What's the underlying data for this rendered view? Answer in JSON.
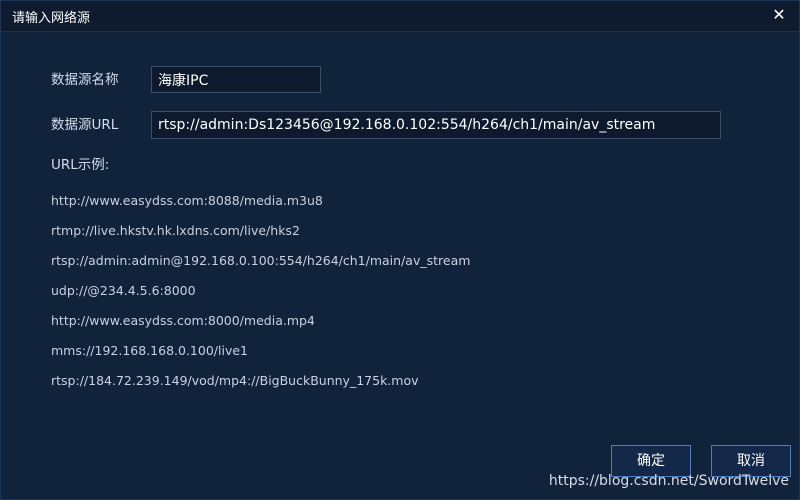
{
  "dialog": {
    "title": "请输入网络源",
    "close_symbol": "✕"
  },
  "form": {
    "name_label": "数据源名称",
    "name_value": "海康IPC",
    "url_label": "数据源URL",
    "url_value": "rtsp://admin:Ds123456@192.168.0.102:554/h264/ch1/main/av_stream"
  },
  "examples": {
    "heading": "URL示例:",
    "items": [
      "http://www.easydss.com:8088/media.m3u8",
      "rtmp://live.hkstv.hk.lxdns.com/live/hks2",
      "rtsp://admin:admin@192.168.0.100:554/h264/ch1/main/av_stream",
      "udp://@234.4.5.6:8000",
      "http://www.easydss.com:8000/media.mp4",
      "mms://192.168.168.0.100/live1",
      "rtsp://184.72.239.149/vod/mp4://BigBuckBunny_175k.mov"
    ]
  },
  "buttons": {
    "ok_label": "确定",
    "cancel_label": "取消"
  },
  "watermark": "https://blog.csdn.net/SwordTwelve",
  "colors": {
    "background": "#11223b",
    "titlebar": "#0e1b2f",
    "button_border": "#4d7fbf",
    "input_border": "#3b4f6b"
  },
  "icons": {
    "close": "close-icon"
  }
}
